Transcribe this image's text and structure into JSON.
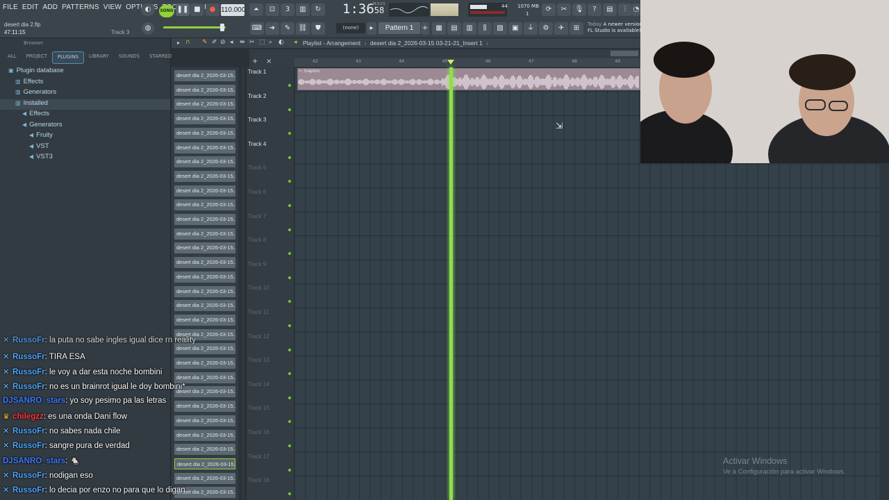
{
  "app": {
    "menu": [
      "FILE",
      "EDIT",
      "ADD",
      "PATTERNS",
      "VIEW",
      "OPTIONS",
      "TOOLS",
      "HELP"
    ],
    "song_mode_label": "SONG",
    "tempo": "110.000",
    "time_main": "1:36",
    "time_sub": "58",
    "time_units": "M:S:CS",
    "cpu_value": "44",
    "memory_value": "1070 MB",
    "memory_value2": "1",
    "pattern_none": "(none)",
    "pattern_name": "Pattern 1",
    "project_file": "desert dia 2.flp",
    "project_time": "47:11:15",
    "project_track": "Track 3",
    "update_today": "Today",
    "update_line1": "A newer version",
    "update_line2": "FL Studio is available!"
  },
  "browser": {
    "header": "Browser",
    "tabs": [
      "ALL",
      "PROJECT",
      "PLUGINS",
      "LIBRARY",
      "SOUNDS",
      "STARRED"
    ],
    "active_tab": "PLUGINS",
    "tree": [
      {
        "label": "Plugin database",
        "indent": 0,
        "icon": "plugin-db-icon"
      },
      {
        "label": "Effects",
        "indent": 1,
        "icon": "folder-icon"
      },
      {
        "label": "Generators",
        "indent": 1,
        "icon": "folder-icon"
      },
      {
        "label": "Installed",
        "indent": 1,
        "icon": "folder-icon"
      },
      {
        "label": "Effects",
        "indent": 2,
        "icon": "speaker-icon"
      },
      {
        "label": "Generators",
        "indent": 2,
        "icon": "speaker-icon"
      },
      {
        "label": "Fruity",
        "indent": 3,
        "icon": "speaker-icon"
      },
      {
        "label": "VST",
        "indent": 3,
        "icon": "speaker-icon"
      },
      {
        "label": "VST3",
        "indent": 3,
        "icon": "speaker-icon"
      }
    ]
  },
  "clips": {
    "label": "desert dia 2_2026-03-15...",
    "count": 30,
    "selected_index": 27
  },
  "playlist": {
    "title": "Playlist - Arrangement",
    "path": "desert dia 2_2026-03-15 03-21-21_Insert 1",
    "ruler": [
      "42",
      "43",
      "44",
      "45",
      "46",
      "47",
      "48",
      "49"
    ],
    "audio_clip_label": "trapton",
    "tracks": [
      "Track 1",
      "Track 2",
      "Track 3",
      "Track 4",
      "Track 5",
      "Track 6",
      "Track 7",
      "Track 8",
      "Track 9",
      "Track 10",
      "Track 11",
      "Track 12",
      "Track 13",
      "Track 14",
      "Track 15",
      "Track 16",
      "Track 17",
      "Track 18"
    ],
    "playhead_bar": 45.2
  },
  "chat": [
    {
      "user": "RussoFr",
      "msg": "la puta no sabe ingles igual dice rn reality",
      "color": "#4fa7ff",
      "badge": "✕",
      "partial": true
    },
    {
      "user": "RussoFr",
      "msg": "TIRA ESA",
      "color": "#4fa7ff",
      "badge": "✕"
    },
    {
      "user": "RussoFr",
      "msg": "le voy a dar esta noche bombini",
      "color": "#4fa7ff",
      "badge": "✕"
    },
    {
      "user": "RussoFr",
      "msg": "no es un brainrot igual le doy bombini*",
      "color": "#4fa7ff",
      "badge": "✕"
    },
    {
      "user": "DJSANRO_stars",
      "msg": "yo soy pesimo pa las letras",
      "color": "#3d7bff",
      "badge": ""
    },
    {
      "user": "chilegzz",
      "msg": "es una onda Dani flow",
      "color": "#ff3b3b",
      "badge": "♛"
    },
    {
      "user": "RussoFr",
      "msg": "no sabes nada chile",
      "color": "#4fa7ff",
      "badge": "✕"
    },
    {
      "user": "RussoFr",
      "msg": "sangre pura de verdad",
      "color": "#4fa7ff",
      "badge": "✕"
    },
    {
      "user": "DJSANRO_stars",
      "msg": "🐁",
      "color": "#3d7bff",
      "badge": ""
    },
    {
      "user": "RussoFr",
      "msg": "nodigan eso",
      "color": "#4fa7ff",
      "badge": "✕"
    },
    {
      "user": "RussoFr",
      "msg": "lo decia por enzo no para que lo digan",
      "color": "#4fa7ff",
      "badge": "✕"
    }
  ],
  "watermark": {
    "title": "Activar Windows",
    "subtitle": "Ve a Configuración para activar Windows."
  },
  "colors": {
    "accent_green": "#8fd13a",
    "playhead": "#8ee04a",
    "clip_fill": "#9b8a93"
  }
}
